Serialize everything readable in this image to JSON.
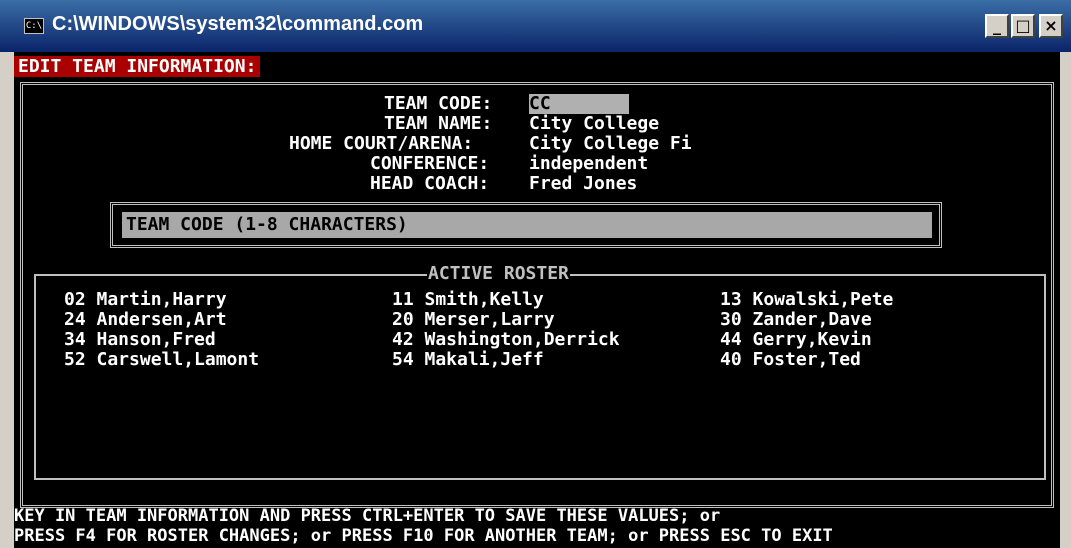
{
  "window": {
    "title": "C:\\WINDOWS\\system32\\command.com",
    "icon_text": "C:\\",
    "controls": [
      "_",
      "□",
      "×"
    ]
  },
  "header": "EDIT TEAM INFORMATION:",
  "form": {
    "team_code_label": "TEAM CODE:",
    "team_code_value": "CC",
    "team_name_label": "TEAM NAME:",
    "team_name_value": "City College",
    "home_court_label": "HOME COURT/ARENA:",
    "home_court_value": "City College Fi",
    "conference_label": "CONFERENCE:",
    "conference_value": "independent",
    "head_coach_label": "HEAD COACH:",
    "head_coach_value": "Fred Jones"
  },
  "prompt": "TEAM CODE (1-8 CHARACTERS)",
  "roster": {
    "title": "ACTIVE ROSTER",
    "players": [
      "02 Martin,Harry",
      "11 Smith,Kelly",
      "13 Kowalski,Pete",
      "24 Andersen,Art",
      "20 Merser,Larry",
      "30 Zander,Dave",
      "34 Hanson,Fred",
      "42 Washington,Derrick",
      "44 Gerry,Kevin",
      "52 Carswell,Lamont",
      "54 Makali,Jeff",
      "40 Foster,Ted"
    ]
  },
  "footer": {
    "line1": "KEY IN TEAM INFORMATION AND PRESS CTRL+ENTER TO SAVE THESE VALUES; or",
    "line2": "PRESS F4 FOR ROSTER CHANGES; or PRESS F10 FOR ANOTHER TEAM; or PRESS ESC TO EXIT"
  },
  "colors": {
    "titlebar": "#0a246a",
    "header_bg": "#aa0000",
    "console_bg": "#000000",
    "text": "#ffffff",
    "input_bg": "#a8a8a8"
  }
}
